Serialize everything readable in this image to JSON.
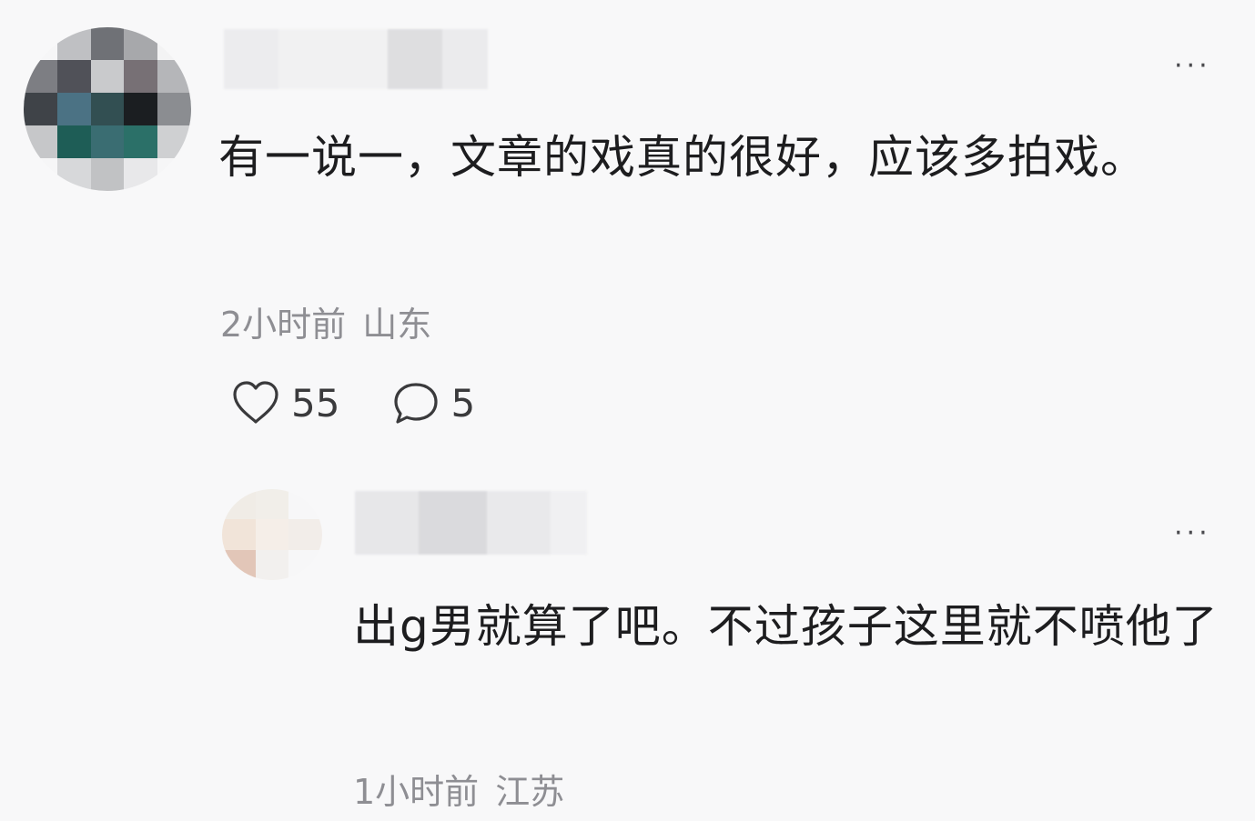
{
  "comment": {
    "text": "有一说一，文章的戏真的很好，应该多拍戏。",
    "time": "2小时前",
    "location": "山东",
    "like_count": "55",
    "reply_count": "5",
    "like_icon": "heart-icon",
    "reply_icon": "comment-bubble-icon",
    "more_icon": "more-options-icon"
  },
  "reply": {
    "text": "出g男就算了吧。不过孩子这里就不喷他了",
    "time": "1小时前",
    "location": "江苏",
    "more_icon": "more-options-icon"
  },
  "colors": {
    "background": "#f8f8f9",
    "text": "#1d1d1f",
    "meta": "#8e8e93"
  }
}
